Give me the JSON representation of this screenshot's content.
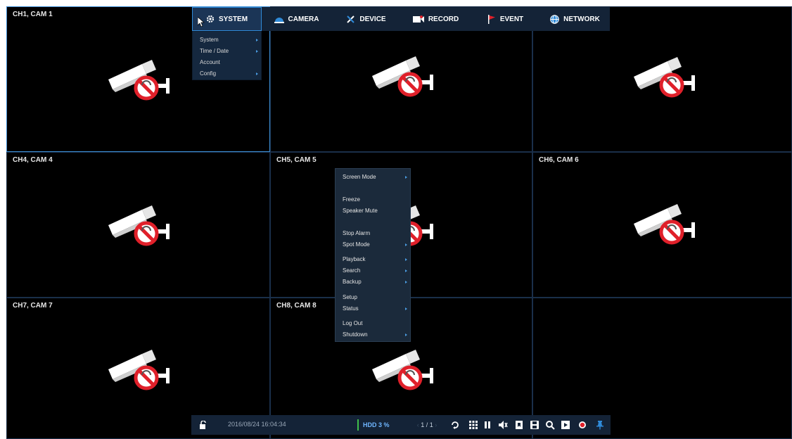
{
  "cameras": [
    {
      "label": "CH1, CAM 1"
    },
    {
      "label": ""
    },
    {
      "label": ""
    },
    {
      "label": "CH4, CAM 4"
    },
    {
      "label": "CH5, CAM 5"
    },
    {
      "label": "CH6, CAM 6"
    },
    {
      "label": "CH7, CAM 7"
    },
    {
      "label": "CH8, CAM 8"
    },
    {
      "label": ""
    }
  ],
  "top_menu": {
    "tabs": [
      {
        "label": "SYSTEM",
        "icon": "gear-icon",
        "active": true
      },
      {
        "label": "CAMERA",
        "icon": "camera-dome-icon"
      },
      {
        "label": "DEVICE",
        "icon": "tools-icon"
      },
      {
        "label": "RECORD",
        "icon": "record-icon"
      },
      {
        "label": "EVENT",
        "icon": "flag-icon"
      },
      {
        "label": "NETWORK",
        "icon": "globe-icon"
      }
    ]
  },
  "system_menu": {
    "items": [
      {
        "label": "System",
        "submenu": true
      },
      {
        "label": "Time / Date",
        "submenu": true
      },
      {
        "label": "Account",
        "submenu": false
      },
      {
        "label": "Config",
        "submenu": true
      }
    ]
  },
  "context_menu": {
    "items": [
      {
        "label": "Screen Mode",
        "submenu": true
      },
      {
        "label": "",
        "disabled": true
      },
      {
        "label": "Freeze"
      },
      {
        "label": "Speaker Mute"
      },
      {
        "label": "",
        "disabled": true
      },
      {
        "label": "Stop Alarm"
      },
      {
        "label": "Spot Mode",
        "submenu": true
      },
      {
        "label": "Playback",
        "submenu": true
      },
      {
        "label": "Search",
        "submenu": true
      },
      {
        "label": "Backup",
        "submenu": true
      },
      {
        "label": "Setup"
      },
      {
        "label": "Status",
        "submenu": true
      },
      {
        "label": "Log Out"
      },
      {
        "label": "Shutdown",
        "submenu": true
      }
    ]
  },
  "status_bar": {
    "datetime": "2016/08/24 16:04:34",
    "hdd": "HDD 3 %",
    "page": "1 / 1",
    "tools": [
      "sequence-icon",
      "grid-layout-icon",
      "pause-icon",
      "mute-icon",
      "bookmark-icon",
      "save-icon",
      "search-icon",
      "playback-icon",
      "record-dot-icon",
      "pin-icon"
    ]
  },
  "colors": {
    "menu_bg": "#142337",
    "accent": "#2f8ad8",
    "alert_red": "#e0202a",
    "hdd_green": "#3fbf4a"
  }
}
